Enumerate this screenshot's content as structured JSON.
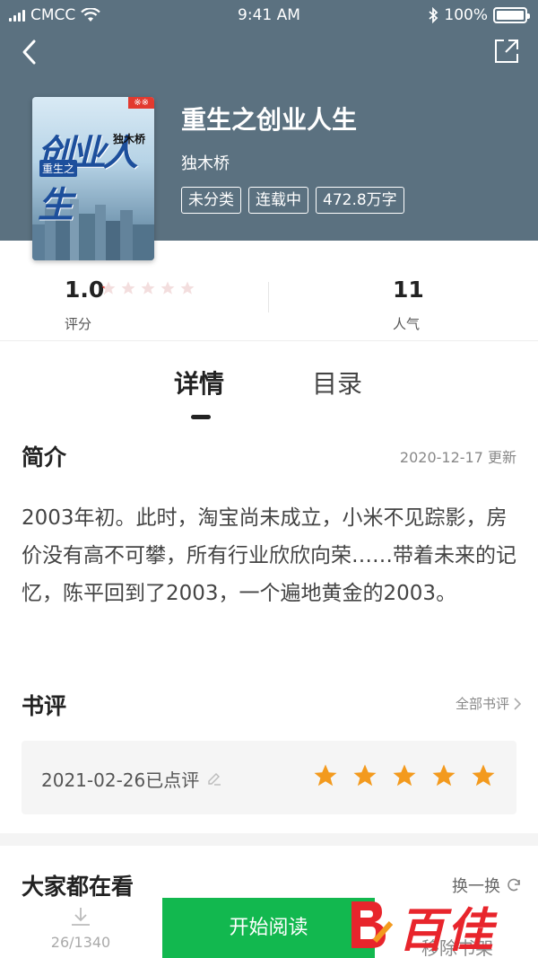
{
  "status_bar": {
    "carrier": "CMCC",
    "time": "9:41 AM",
    "battery": "100%"
  },
  "book": {
    "title": "重生之创业人生",
    "author": "独木桥",
    "tags": [
      "未分类",
      "连载中",
      "472.8万字"
    ],
    "cover": {
      "title_text": "创业人生",
      "subtitle": "重生之",
      "author": "独木桥"
    }
  },
  "stats": {
    "rating_value": "1.0",
    "rating_label": "评分",
    "rating_stars": 0.2,
    "popularity_value": "11",
    "popularity_label": "人气"
  },
  "tabs": [
    {
      "label": "详情"
    },
    {
      "label": "目录"
    }
  ],
  "intro": {
    "title": "简介",
    "updated": "2020-12-17 更新",
    "text": "2003年初。此时，淘宝尚未成立，小米不见踪影，房价没有高不可攀，所有行业欣欣向荣……带着未来的记忆，陈平回到了2003，一个遍地黄金的2003。"
  },
  "reviews": {
    "title": "书评",
    "all_label": "全部书评",
    "my_review_label": "2021-02-26已点评",
    "my_review_stars": 5
  },
  "others": {
    "title": "大家都在看",
    "swap_label": "换一换"
  },
  "bottom_bar": {
    "download_progress": "26/1340",
    "read_label": "开始阅读",
    "shelf_label": "移除书架"
  },
  "watermark": {
    "text": "百佳"
  },
  "colors": {
    "header_bg": "#5b7180",
    "accent_green": "#12b84f",
    "star_orange": "#f39a1e",
    "star_red": "#e8403a"
  }
}
